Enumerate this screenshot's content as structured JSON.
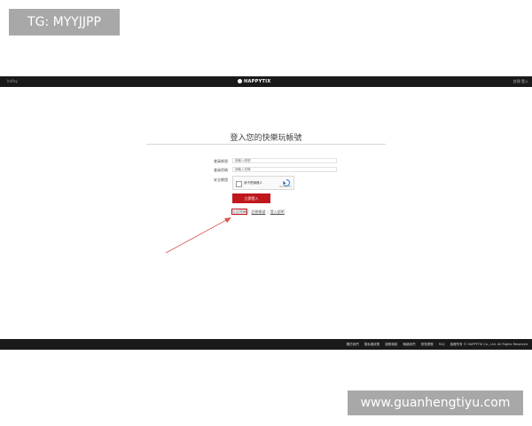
{
  "watermark": {
    "top_text": "TG: MYYJJPP",
    "bottom_text": "www.guanhengtiyu.com"
  },
  "topbar": {
    "brand": "ImPay",
    "logo_text": "HAPPYTIX",
    "right_text": "註冊 登入"
  },
  "login": {
    "title": "登入您的快樂玩帳號",
    "account_label": "會員帳號",
    "account_placeholder": "請輸入帳號",
    "password_label": "會員密碼",
    "password_placeholder": "請輸入密碼",
    "verify_label": "安全驗證",
    "captcha_text": "我不是機器人",
    "captcha_brand": "reCAPTCHA",
    "submit_label": "立即登入",
    "link_forgot": "忘記密碼",
    "link_register": "註冊帳號",
    "link_help": "登入說明"
  },
  "footer": {
    "links": [
      "關於我們",
      "隱私權政策",
      "服務條款",
      "聯絡我們",
      "常見問題",
      "FAQ",
      "版權所有 © HAPPYTIX Co., Ltd. All Rights Reserved."
    ]
  },
  "colors": {
    "brand_red": "#c0171d",
    "header_bg": "#1a1a1a"
  }
}
